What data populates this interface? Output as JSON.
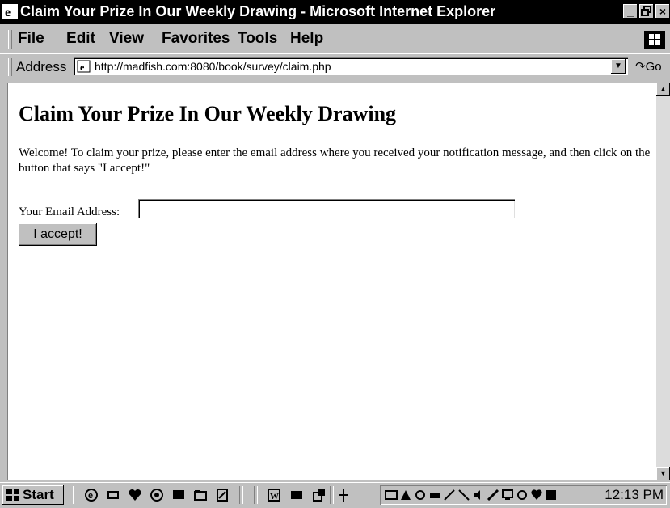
{
  "window": {
    "title": "Claim Your Prize In Our Weekly Drawing - Microsoft Internet Explorer",
    "controls": [
      "_",
      "8",
      "×"
    ]
  },
  "menubar": {
    "items": [
      {
        "label": "File",
        "key": "F",
        "rest": "ile"
      },
      {
        "label": "Edit",
        "key": "E",
        "rest": "dit"
      },
      {
        "label": "View",
        "key": "V",
        "rest": "iew"
      },
      {
        "label": "Favorites",
        "pre": "F",
        "key": "a",
        "rest": "vorites"
      },
      {
        "label": "Tools",
        "key": "T",
        "rest": "ools"
      },
      {
        "label": "Help",
        "key": "H",
        "rest": "elp"
      }
    ]
  },
  "addressbar": {
    "label": "Address",
    "url": "http://madfish.com:8080/book/survey/claim.php",
    "go_label": "Go"
  },
  "page": {
    "heading": "Claim Your Prize In Our Weekly Drawing",
    "intro": "Welcome! To claim your prize, please enter the email address where you received your notification message, and then click on the button that says \"I accept!\"",
    "email_label": "Your Email Address:",
    "email_value": "",
    "submit_label": "I accept!"
  },
  "taskbar": {
    "start_label": "Start",
    "clock": "12:13 PM"
  },
  "icons": {
    "browser": "internet-explorer-icon",
    "page": "web-page-icon",
    "windows_logo": "windows-logo-icon"
  }
}
